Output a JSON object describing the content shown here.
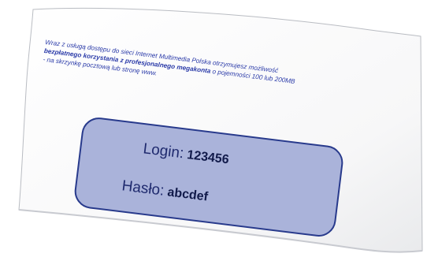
{
  "notice": {
    "line1": "Wraz z usługą dostępu do sieci Internet Multimedia Polska otrzymujesz możliwość",
    "line2_bold": "bezpłatnego korzystania z profesjonalnego megakonta",
    "line2_rest": " o pojemności 100 lub 200MB",
    "line3": "- na skrzynkę pocztową lub stronę www."
  },
  "credentials": {
    "login_label": "Login:",
    "login_value": "123456",
    "password_label": "Hasło:",
    "password_value": "abcdef"
  },
  "colors": {
    "text_blue": "#2a3aa8",
    "box_fill": "#aab3da",
    "box_border": "#283a8c"
  }
}
